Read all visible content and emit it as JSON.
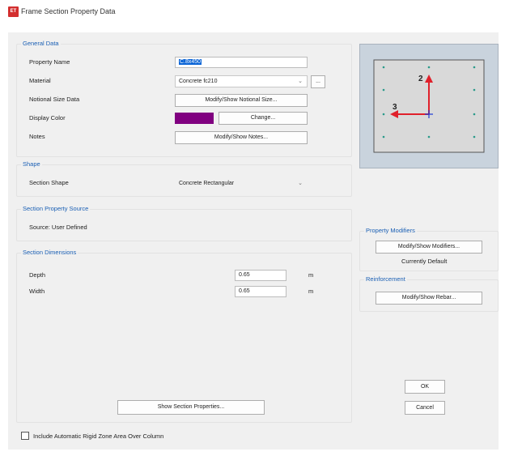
{
  "window": {
    "title": "Frame Section Property Data",
    "icon_label": "ET"
  },
  "general_data": {
    "title": "General Data",
    "property_name_label": "Property Name",
    "property_name_value": "C.8x450",
    "material_label": "Material",
    "material_value": "Concrete fc210",
    "notional_size_label": "Notional Size Data",
    "notional_size_button": "Modify/Show Notional Size...",
    "display_color_label": "Display Color",
    "display_color_value": "#800080",
    "change_button": "Change...",
    "notes_label": "Notes",
    "notes_button": "Modify/Show Notes..."
  },
  "shape": {
    "title": "Shape",
    "section_shape_label": "Section Shape",
    "section_shape_value": "Concrete Rectangular"
  },
  "section_property_source": {
    "title": "Section Property Source",
    "source_text": "Source:  User Defined"
  },
  "section_dimensions": {
    "title": "Section Dimensions",
    "depth_label": "Depth",
    "depth_value": "0.65",
    "depth_unit": "m",
    "width_label": "Width",
    "width_value": "0.65",
    "width_unit": "m",
    "show_properties_button": "Show Section Properties..."
  },
  "preview": {
    "axis2_label": "2",
    "axis3_label": "3"
  },
  "property_modifiers": {
    "title": "Property Modifiers",
    "button": "Modify/Show Modifiers...",
    "status": "Currently Default"
  },
  "reinforcement": {
    "title": "Reinforcement",
    "button": "Modify/Show Rebar..."
  },
  "ok_button": "OK",
  "cancel_button": "Cancel",
  "rigid_zone_checkbox_label": "Include Automatic Rigid Zone Area Over Column"
}
